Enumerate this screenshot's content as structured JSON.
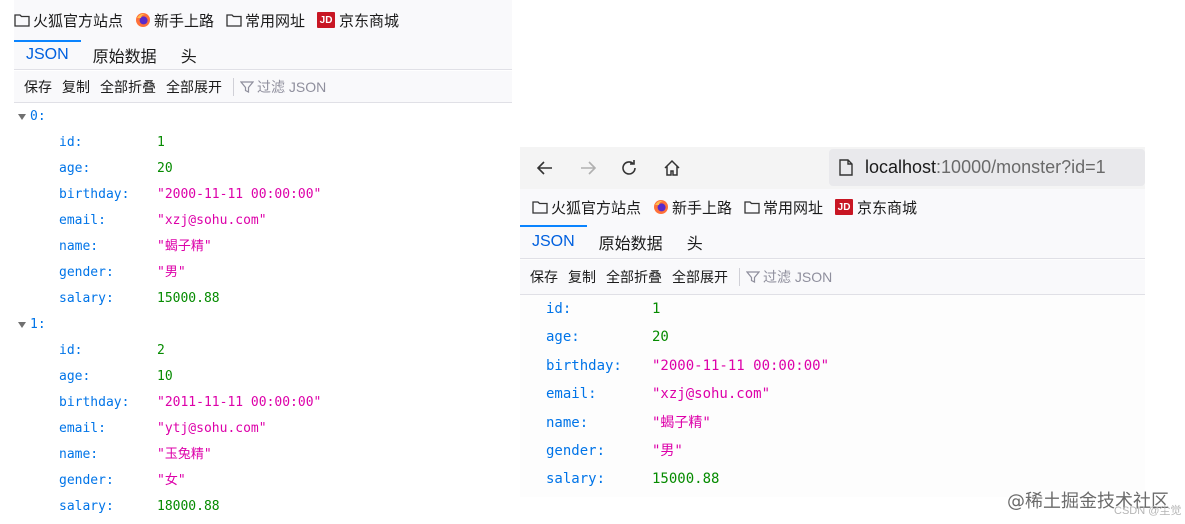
{
  "bookmarks": [
    {
      "label": "火狐官方站点",
      "icon": "folder-icon"
    },
    {
      "label": "新手上路",
      "icon": "firefox-icon"
    },
    {
      "label": "常用网址",
      "icon": "folder-icon"
    },
    {
      "label": "京东商城",
      "icon": "jd-icon",
      "badge": "JD"
    }
  ],
  "tabs": [
    "JSON",
    "原始数据",
    "头"
  ],
  "toolbar": {
    "save": "保存",
    "copy": "复制",
    "collapse_all": "全部折叠",
    "expand_all": "全部展开",
    "filter_placeholder": "过滤 JSON"
  },
  "right_window": {
    "url_host": "localhost",
    "url_rest": ":10000/monster?id=1"
  },
  "left_json": [
    {
      "index": "0:",
      "fields": [
        {
          "key": "id:",
          "value": "1",
          "type": "num"
        },
        {
          "key": "age:",
          "value": "20",
          "type": "num"
        },
        {
          "key": "birthday:",
          "value": "\"2000-11-11 00:00:00\"",
          "type": "str"
        },
        {
          "key": "email:",
          "value": "\"xzj@sohu.com\"",
          "type": "str"
        },
        {
          "key": "name:",
          "value": "\"蝎子精\"",
          "type": "str"
        },
        {
          "key": "gender:",
          "value": "\"男\"",
          "type": "str"
        },
        {
          "key": "salary:",
          "value": "15000.88",
          "type": "num"
        }
      ]
    },
    {
      "index": "1:",
      "fields": [
        {
          "key": "id:",
          "value": "2",
          "type": "num"
        },
        {
          "key": "age:",
          "value": "10",
          "type": "num"
        },
        {
          "key": "birthday:",
          "value": "\"2011-11-11 00:00:00\"",
          "type": "str"
        },
        {
          "key": "email:",
          "value": "\"ytj@sohu.com\"",
          "type": "str"
        },
        {
          "key": "name:",
          "value": "\"玉兔精\"",
          "type": "str"
        },
        {
          "key": "gender:",
          "value": "\"女\"",
          "type": "str"
        },
        {
          "key": "salary:",
          "value": "18000.88",
          "type": "num"
        }
      ]
    }
  ],
  "right_json": [
    {
      "key": "id:",
      "value": "1",
      "type": "num"
    },
    {
      "key": "age:",
      "value": "20",
      "type": "num"
    },
    {
      "key": "birthday:",
      "value": "\"2000-11-11 00:00:00\"",
      "type": "str"
    },
    {
      "key": "email:",
      "value": "\"xzj@sohu.com\"",
      "type": "str"
    },
    {
      "key": "name:",
      "value": "\"蝎子精\"",
      "type": "str"
    },
    {
      "key": "gender:",
      "value": "\"男\"",
      "type": "str"
    },
    {
      "key": "salary:",
      "value": "15000.88",
      "type": "num"
    }
  ],
  "watermark": "@稀土掘金技术社区",
  "watermark_small": "CSDN @尘觉",
  "colors": {
    "key": "#0074e8",
    "number": "#058b00",
    "string": "#dd00a9",
    "active_tab": "#0060df",
    "jd_red": "#c81623"
  }
}
